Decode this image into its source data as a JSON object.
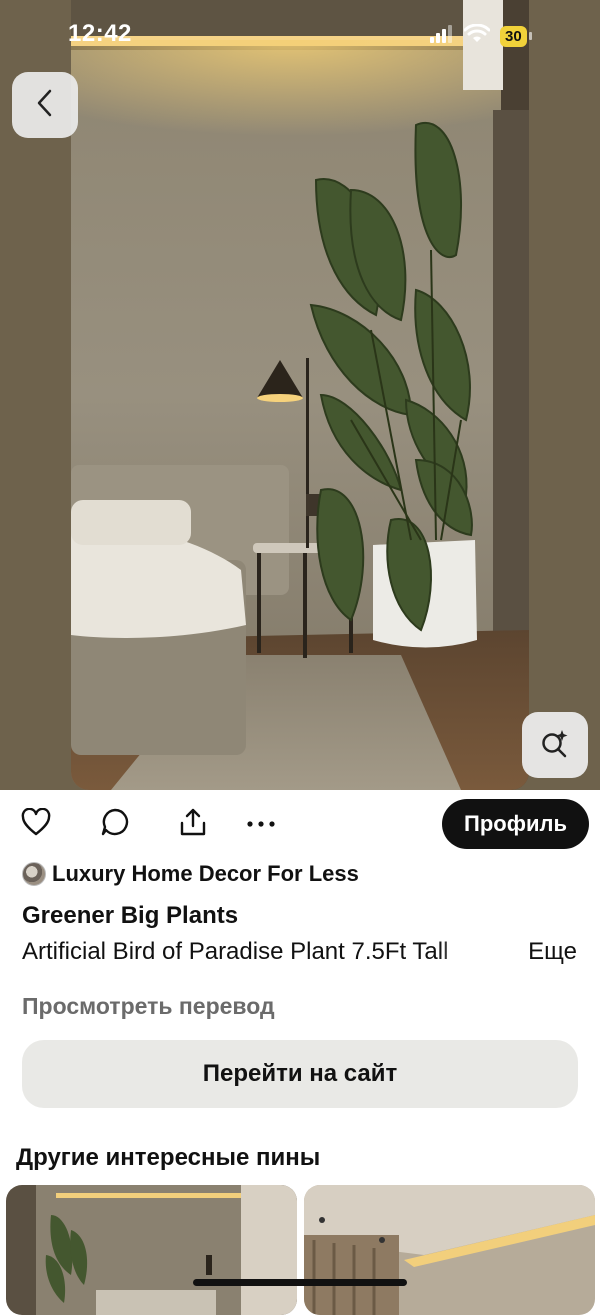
{
  "status_bar": {
    "time": "12:42",
    "battery": "30"
  },
  "pin": {
    "author": "Luxury Home Decor For Less",
    "title": "Greener Big Plants",
    "description": "Artificial Bird of Paradise Plant 7.5Ft Tall",
    "more_label": "Еще",
    "translate_label": "Просмотреть перевод",
    "visit_label": "Перейти на сайт"
  },
  "actions": {
    "profile_label": "Профиль"
  },
  "more_pins": {
    "heading": "Другие интересные пины"
  },
  "icons": {
    "back": "chevron-left-icon",
    "lens": "visual-search-icon",
    "like": "heart-icon",
    "comment": "comment-icon",
    "share": "share-icon",
    "more": "ellipsis-icon"
  },
  "colors": {
    "accent_dark": "#111111",
    "button_light": "#e9e9e6",
    "muted_text": "#6b6b6b"
  }
}
